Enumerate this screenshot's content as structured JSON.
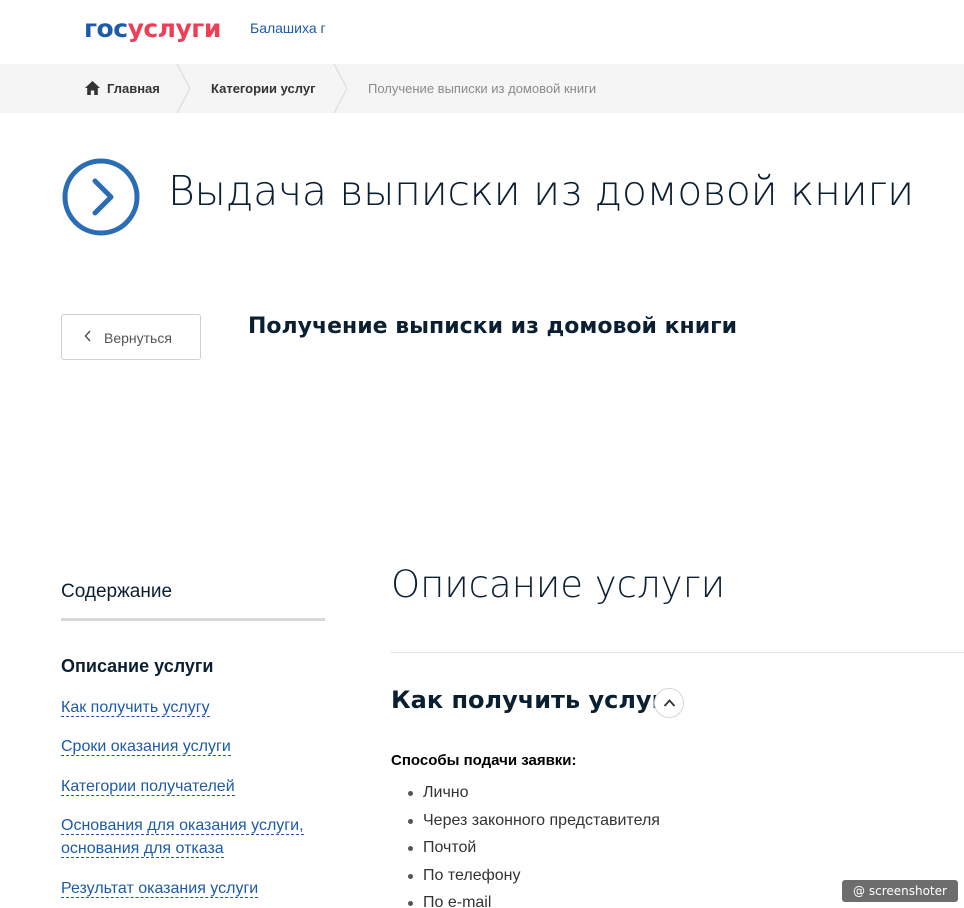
{
  "header": {
    "logo_part1": "гос",
    "logo_part2": "услуги",
    "city": "Балашиха г"
  },
  "breadcrumbs": {
    "home": "Главная",
    "categories": "Категории услуг",
    "current": "Получение выписки из домовой книги"
  },
  "page": {
    "title": "Выдача выписки из домовой книги",
    "back_label": "Вернуться",
    "subtitle": "Получение выписки из домовой книги"
  },
  "toc": {
    "title": "Содержание",
    "active": "Описание услуги",
    "links": [
      "Как получить услугу",
      "Сроки оказания услуги",
      "Категории получателей",
      "Основания для оказания услуги,",
      "основания для отказа",
      "Результат оказания услуги"
    ]
  },
  "main": {
    "section_title": "Описание услуги",
    "subsection_title": "Как получить услугу",
    "methods_label": "Способы подачи заявки:",
    "methods": [
      "Лично",
      "Через законного представителя",
      "Почтой",
      "По телефону",
      "По e-mail"
    ]
  },
  "watermark": "@ screenshoter",
  "colors": {
    "brand_blue": "#1d5aa8",
    "brand_red": "#ee3f58",
    "title_icon": "#2a6db5"
  }
}
